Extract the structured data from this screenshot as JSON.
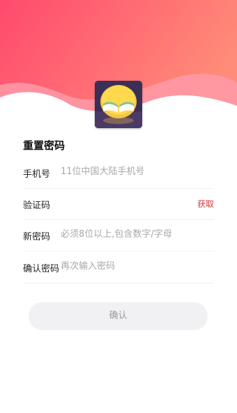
{
  "colors": {
    "header_gradient_start": "#ff4f6f",
    "header_gradient_end": "#ff8a7a",
    "accent": "#d9363e",
    "button_bg": "#f1f1f3"
  },
  "logo": {
    "icon": "book-mascot-logo"
  },
  "page": {
    "title": "重置密码"
  },
  "form": {
    "phone": {
      "label": "手机号",
      "placeholder": "11位中国大陆手机号",
      "value": ""
    },
    "code": {
      "label": "验证码",
      "placeholder": "",
      "value": "",
      "get_code": "获取"
    },
    "password": {
      "label": "新密码",
      "placeholder": "必须8位以上,包含数字/字母",
      "value": ""
    },
    "confirm_password": {
      "label": "确认密码",
      "placeholder": "再次输入密码",
      "value": ""
    }
  },
  "confirm_button": {
    "label": "确认"
  }
}
